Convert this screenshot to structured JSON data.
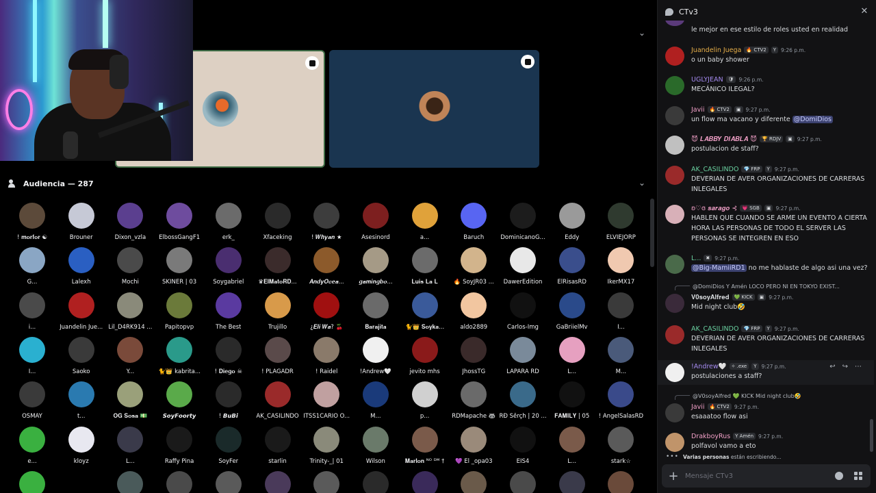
{
  "audience": {
    "title": "Audiencia — 287",
    "members": [
      {
        "name": "! 𝐦𝐨𝐫𝐟𝐨𝐫 ☯",
        "color": "#5c4a3a"
      },
      {
        "name": "Brouner",
        "color": "#c6c9d6"
      },
      {
        "name": "Dixon_vzla",
        "color": "#5b3f8f"
      },
      {
        "name": "ElbossGangF1",
        "color": "#6e4c9e"
      },
      {
        "name": "erk_",
        "color": "#6b6b6b"
      },
      {
        "name": "Xfaceking",
        "color": "#2a2a2a"
      },
      {
        "name": "! 𝑾𝒉𝒚𝒂𝒏 ★",
        "color": "#3d3d3d"
      },
      {
        "name": "Asesinord",
        "color": "#7d1f1f"
      },
      {
        "name": "a...",
        "color": "#e0a23a"
      },
      {
        "name": "Baruch",
        "color": "#5865f2"
      },
      {
        "name": "DominicanoG...",
        "color": "#1c1c1c"
      },
      {
        "name": "Eddy",
        "color": "#9a9a9a"
      },
      {
        "name": "ELVIEJORP",
        "color": "#2f3a2f"
      },
      {
        "name": "G...",
        "color": "#8aa6c4"
      },
      {
        "name": "Lalexh",
        "color": "#2a5fc2"
      },
      {
        "name": "Mochi",
        "color": "#4a4a4a"
      },
      {
        "name": "SKINER | 03",
        "color": "#7a7a7a"
      },
      {
        "name": "Soygabriel",
        "color": "#4a2e70"
      },
      {
        "name": "♛𝐄𝐥𝐌𝐚𝐭𝐨𝐑𝐃...",
        "color": "#3b2b2b"
      },
      {
        "name": "𝑨𝒏𝒅𝒚𝑶𝒄𝒆𝒂...",
        "color": "#8c5a2b"
      },
      {
        "name": "𝒈𝒂𝒎𝒊𝒏𝒈𝒃𝒐...",
        "color": "#a59a86"
      },
      {
        "name": "𝐋𝐮𝐢𝐬 𝐋𝐚 𝐋",
        "color": "#6b6b6b"
      },
      {
        "name": "🔥 SoyJR03 ...",
        "color": "#d2b48c"
      },
      {
        "name": "DawerEdition",
        "color": "#e8e8e8"
      },
      {
        "name": "ElRisasRD",
        "color": "#3a4e8c"
      },
      {
        "name": "IkerMX17",
        "color": "#f0c9b0"
      },
      {
        "name": "i...",
        "color": "#4a4a4a"
      },
      {
        "name": "Juandelin Jue...",
        "color": "#b02020"
      },
      {
        "name": "Lil_D4RK914 ...",
        "color": "#8a8a7a"
      },
      {
        "name": "Papitopvp",
        "color": "#6b7a3a"
      },
      {
        "name": "The Best",
        "color": "#5a3aa0"
      },
      {
        "name": "Trujillo",
        "color": "#d89a4a"
      },
      {
        "name": "¿𝑬𝒍𝒊 𝑾𝒂? 🍒",
        "color": "#a01010"
      },
      {
        "name": "𝐁𝐚𝐫𝐚𝐣𝐢𝐭𝐚",
        "color": "#6a6a6a"
      },
      {
        "name": "🐈👑 𝐒𝐨𝐲𝐤𝐚...",
        "color": "#3a5a9a"
      },
      {
        "name": "aldo2889",
        "color": "#f2c6a0"
      },
      {
        "name": "Carlos-Img",
        "color": "#111111"
      },
      {
        "name": "GaBriielMv",
        "color": "#2a4a8a"
      },
      {
        "name": "I...",
        "color": "#3a3a3a"
      },
      {
        "name": "I...",
        "color": "#2ab0d0"
      },
      {
        "name": "Saoko",
        "color": "#3a3a3a"
      },
      {
        "name": "Y...",
        "color": "#7a4a3a"
      },
      {
        "name": "🐈👑 kabrita...",
        "color": "#2a9a8a"
      },
      {
        "name": "! 𝐃𝐢𝐞𝐠𝐨 ☠",
        "color": "#2a2a2a"
      },
      {
        "name": "! PLAGADR",
        "color": "#5a4a4a"
      },
      {
        "name": "! Raidel",
        "color": "#8a7a6a"
      },
      {
        "name": "!Andrew🤍",
        "color": "#f0f0f0"
      },
      {
        "name": "jevito mhs",
        "color": "#8a1a1a"
      },
      {
        "name": "JhossTG",
        "color": "#3a2a2a"
      },
      {
        "name": "LAPARA RD",
        "color": "#7a8a9a"
      },
      {
        "name": "L...",
        "color": "#e6a0c0"
      },
      {
        "name": "M...",
        "color": "#4a5a7a"
      },
      {
        "name": "OSMAY",
        "color": "#3a3a3a"
      },
      {
        "name": "t...",
        "color": "#2a7ab0"
      },
      {
        "name": "𝐎𝐆 𝐒𝐨𝐬𝐚 💵",
        "color": "#9aa07a"
      },
      {
        "name": "𝙎𝙤𝙮𝙁𝙤𝙤𝙧𝙩𝙮",
        "color": "#5aaa4a"
      },
      {
        "name": "! 𝘽𝙪𝘽𝙞",
        "color": "#2a2a2a"
      },
      {
        "name": "AK_CASILINDO",
        "color": "#9a2a2a"
      },
      {
        "name": "ITSS1CARIO O...",
        "color": "#c0a0a0"
      },
      {
        "name": "M...",
        "color": "#1a3a7a"
      },
      {
        "name": "p...",
        "color": "#d0d0d0"
      },
      {
        "name": "RDMapache 🦝",
        "color": "#6a6a6a"
      },
      {
        "name": "RĐ Šěrçh | 20 ...",
        "color": "#3a6a8a"
      },
      {
        "name": "𝐅𝐀𝐌𝐈𝐋𝐘 | 05",
        "color": "#111111"
      },
      {
        "name": "! AngelSalasRD",
        "color": "#3a4a8a"
      },
      {
        "name": "e...",
        "color": "#3ab040"
      },
      {
        "name": "kloyz",
        "color": "#e8e8f0"
      },
      {
        "name": "L...",
        "color": "#3a3a4a"
      },
      {
        "name": "Raffy Pina",
        "color": "#1a1a1a"
      },
      {
        "name": "SoyFer",
        "color": "#1a2a2a"
      },
      {
        "name": "starlin",
        "color": "#1a1a1a"
      },
      {
        "name": "Trinity-_| 01",
        "color": "#8a8a7a"
      },
      {
        "name": "Wilson",
        "color": "#6a7a6a"
      },
      {
        "name": "𝐌𝐚𝐫𝐥𝐨𝐧 ᴺᴼ ᴰᴹ †",
        "color": "#7a5a4a"
      },
      {
        "name": "💜 El _opa03",
        "color": "#9a8a7a"
      },
      {
        "name": "EIS4",
        "color": "#111111"
      },
      {
        "name": "L...",
        "color": "#7a5a4a"
      },
      {
        "name": "stark☆",
        "color": "#5a5a5a"
      },
      {
        "name": "",
        "color": "#3ab040"
      },
      {
        "name": "",
        "color": "#000000"
      },
      {
        "name": "",
        "color": "#4a5a5a"
      },
      {
        "name": "",
        "color": "#4a4a4a"
      },
      {
        "name": "",
        "color": "#5a5a5a"
      },
      {
        "name": "",
        "color": "#4a3a5a"
      },
      {
        "name": "",
        "color": "#5a5a5a"
      },
      {
        "name": "",
        "color": "#2a2a2a"
      },
      {
        "name": "",
        "color": "#3a2a5a"
      },
      {
        "name": "",
        "color": "#6a5a4a"
      },
      {
        "name": "",
        "color": "#4a4a4a"
      },
      {
        "name": "",
        "color": "#3a3a4a"
      },
      {
        "name": "",
        "color": "#6a4a3a"
      }
    ]
  },
  "chat": {
    "title": "CTv3",
    "input_placeholder": "Mensaje CTv3",
    "typing_who": "Varias personas",
    "typing_rest": "están escribiendo...",
    "messages": [
      {
        "author": "",
        "author_color": "#dbdee1",
        "badges": [],
        "time": "",
        "text": "le mejor en ese estilo de roles usted  en realidad",
        "avatar": "#5a3a7a"
      },
      {
        "author": "Juandelin Juega",
        "author_color": "#e8b04a",
        "badges": [
          "🔥 CTV2",
          "Y"
        ],
        "time": "9:26 p.m.",
        "text": "o un baby shower",
        "avatar": "#b02020"
      },
      {
        "author": "UGLYJEAN",
        "author_color": "#a58bf0",
        "badges": [
          "🛡"
        ],
        "time": "9:26 p.m.",
        "text": "MECÁNICO ILEGAL?",
        "avatar": "#2a6a2a"
      },
      {
        "author": "Javii",
        "author_color": "#f2a0c8",
        "badges": [
          "🔥 CTV2",
          "▣"
        ],
        "time": "9:27 p.m.",
        "text": "un flow ma vacano y diferente",
        "mention": "@DomiDios",
        "avatar": "#3a3a3a"
      },
      {
        "author": "😈 𝑳𝑨𝑩𝑩𝒀 𝑫𝑰𝑨𝑩𝑳𝑨 😈",
        "author_color": "#f2a0c8",
        "badges": [
          "🏆 RDJV",
          "▣"
        ],
        "time": "9:27 p.m.",
        "text": "postulacion de staff?",
        "avatar": "#c0c0c0"
      },
      {
        "author": "AK_CASILINDO",
        "author_color": "#6ad0a0",
        "badges": [
          "💎 FRP",
          "Y"
        ],
        "time": "9:27 p.m.",
        "text": "DEVERIAN DE AVER  ORGANIZACIONES  DE CARRERAS INLEGALES",
        "avatar": "#9a2a2a"
      },
      {
        "author": "ʚ♡ɞ 𝒔𝒂𝒓𝒂𝒈𝒐 ⊰",
        "author_color": "#f2a0c8",
        "badges": [
          "💗 SGB",
          "▣"
        ],
        "time": "9:27 p.m.",
        "text": "HABLEN QUE CUANDO SE ARME UN EVENTO A CIERTA HORA LAS PERSONAS DE TODO EL SERVER LAS PERSONAS SE INTEGREN EN ESO",
        "avatar": "#d8b0b8"
      },
      {
        "author": "L...",
        "author_color": "#6ad0a0",
        "badges": [
          "✖"
        ],
        "time": "9:27 p.m.",
        "text": "no me hablaste de algo asi una vez?",
        "mention": "@Big-MamiiRD1",
        "avatar": "#4a6a4a"
      },
      {
        "author": "𝐕𝟎𝐬𝐨𝐲𝐀𝐥𝐟𝐫𝐞𝐝",
        "author_color": "#dbdee1",
        "badges": [
          "💚 KICK",
          "▣"
        ],
        "time": "9:27 p.m.",
        "text": "Mid night club🤣",
        "reply": "@DomiDios  Y Amén  LOCO PERO NI EN TOKYO EXIST...",
        "avatar": "#3a2a3a"
      },
      {
        "author": "AK_CASILINDO",
        "author_color": "#6ad0a0",
        "badges": [
          "💎 FRP",
          "Y"
        ],
        "time": "9:27 p.m.",
        "text": "DEVERIAN DE AVER  ORGANIZACIONES  DE CARRERAS INLEGALES",
        "avatar": "#9a2a2a"
      },
      {
        "author": "!Andrew🤍",
        "author_color": "#a58bf0",
        "badges": [
          "✧ .exe",
          "Y"
        ],
        "time": "9:27 p.m.",
        "text": "postulaciones a staff?",
        "avatar": "#f0f0f0"
      },
      {
        "author": "Javii",
        "author_color": "#f2a0c8",
        "badges": [
          "🔥 CTV2"
        ],
        "time": "9:27 p.m.",
        "text": "esaaatoo flow asi",
        "reply": "@V0soyAlfred  💚 KICK  Mid night club🤣",
        "avatar": "#3a3a3a"
      },
      {
        "author": "DrakboyRus",
        "author_color": "#f2a0c8",
        "badges": [
          "Y Amén"
        ],
        "time": "9:27 p.m.",
        "text": "polfavol vamo a eto",
        "avatar": "#c0946a"
      }
    ]
  },
  "colors": {
    "accent": "#5865f2",
    "online_border": "#3e6c45"
  }
}
